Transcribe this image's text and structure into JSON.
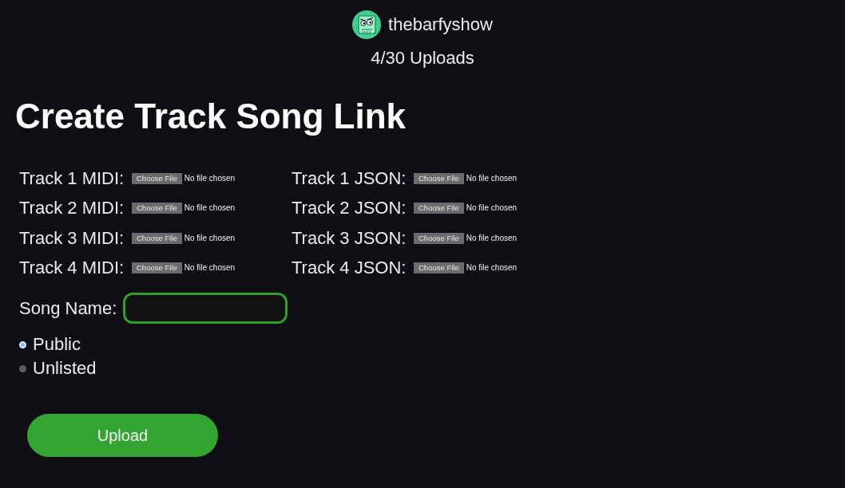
{
  "header": {
    "username": "thebarfyshow",
    "uploads": "4/30 Uploads"
  },
  "title": "Create Track Song Link",
  "file_fields": [
    {
      "label": "Track 1 MIDI:",
      "button": "Choose File",
      "status": "No file chosen"
    },
    {
      "label": "Track 1 JSON:",
      "button": "Choose File",
      "status": "No file chosen"
    },
    {
      "label": "Track 2 MIDI:",
      "button": "Choose File",
      "status": "No file chosen"
    },
    {
      "label": "Track 2 JSON:",
      "button": "Choose File",
      "status": "No file chosen"
    },
    {
      "label": "Track 3 MIDI:",
      "button": "Choose File",
      "status": "No file chosen"
    },
    {
      "label": "Track 3 JSON:",
      "button": "Choose File",
      "status": "No file chosen"
    },
    {
      "label": "Track 4 MIDI:",
      "button": "Choose File",
      "status": "No file chosen"
    },
    {
      "label": "Track 4 JSON:",
      "button": "Choose File",
      "status": "No file chosen"
    }
  ],
  "song_name": {
    "label": "Song Name:"
  },
  "visibility": [
    {
      "label": "Public",
      "selected": true
    },
    {
      "label": "Unlisted",
      "selected": false
    }
  ],
  "upload_button": "Upload"
}
